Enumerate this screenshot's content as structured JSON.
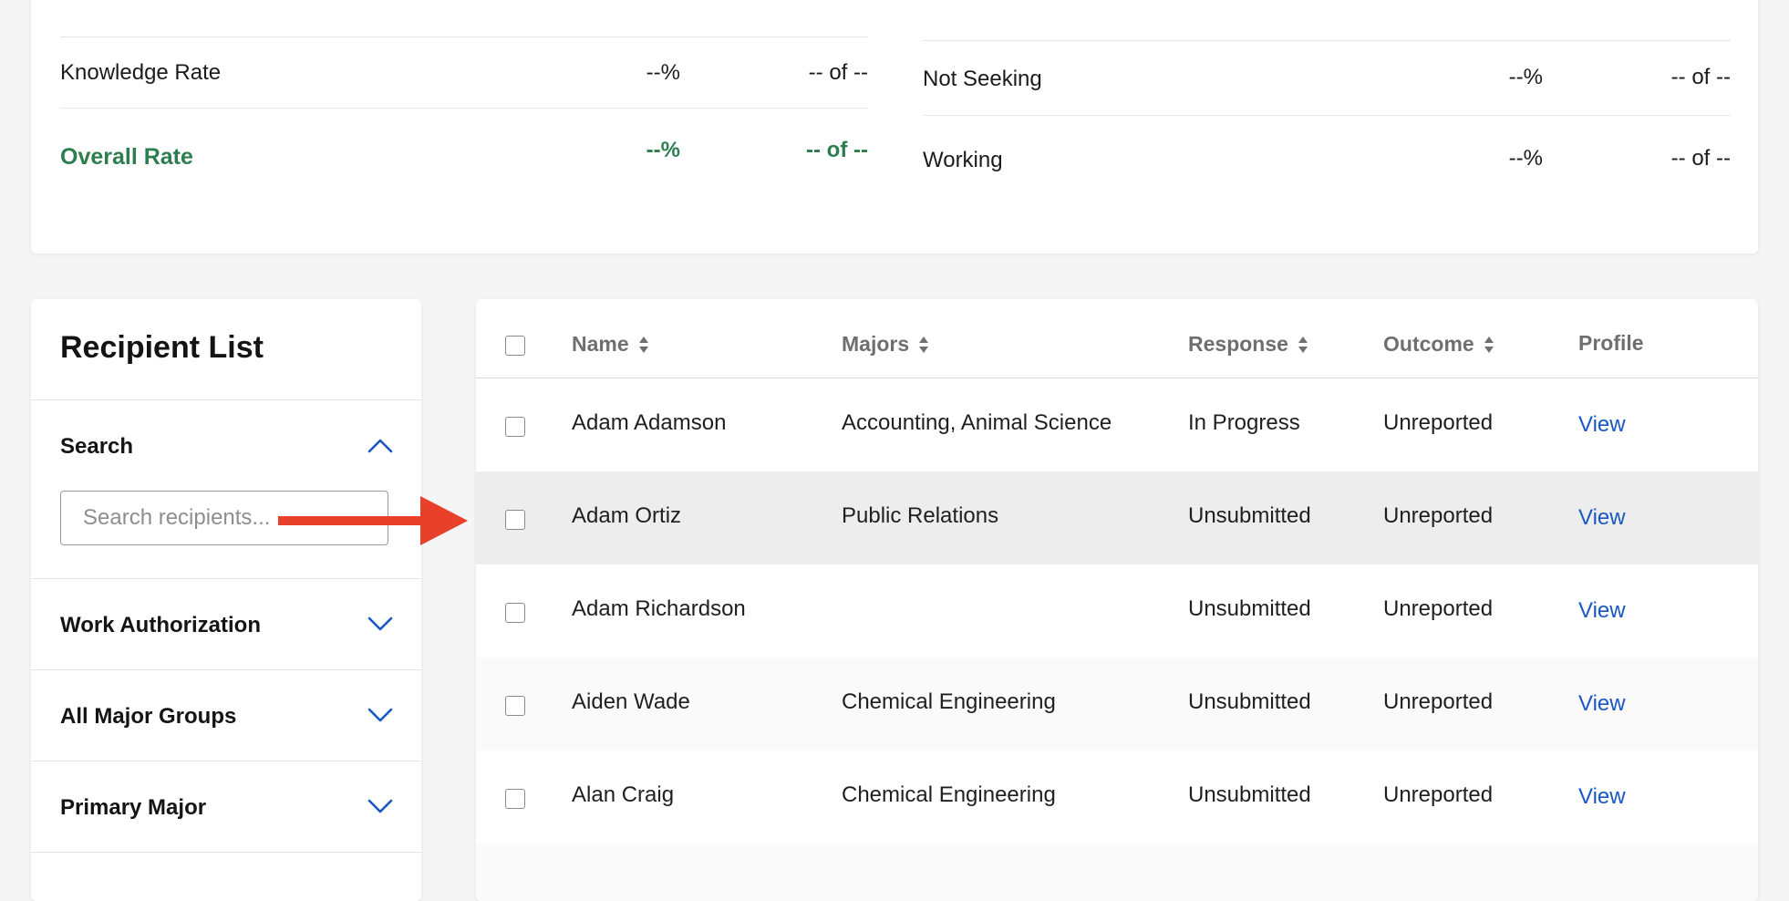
{
  "stats": {
    "left": [
      {
        "label": "Knowledge Rate",
        "pct": "--%",
        "of": "-- of --"
      },
      {
        "label": "Overall Rate",
        "pct": "--%",
        "of": "-- of --"
      }
    ],
    "right": [
      {
        "label": "Not Seeking",
        "pct": "--%",
        "of": "-- of --"
      },
      {
        "label": "Working",
        "pct": "--%",
        "of": "-- of --"
      }
    ]
  },
  "sidebar": {
    "title": "Recipient List",
    "search": {
      "label": "Search",
      "placeholder": "Search recipients..."
    },
    "filters": [
      {
        "label": "Work Authorization"
      },
      {
        "label": "All Major Groups"
      },
      {
        "label": "Primary Major"
      }
    ]
  },
  "table": {
    "headers": {
      "name": "Name",
      "majors": "Majors",
      "response": "Response",
      "outcome": "Outcome",
      "profile": "Profile"
    },
    "rows": [
      {
        "name": "Adam Adamson",
        "majors": "Accounting, Animal Science",
        "response": "In Progress",
        "outcome": "Unreported",
        "profile": "View"
      },
      {
        "name": "Adam Ortiz",
        "majors": "Public Relations",
        "response": "Unsubmitted",
        "outcome": "Unreported",
        "profile": "View"
      },
      {
        "name": "Adam Richardson",
        "majors": "",
        "response": "Unsubmitted",
        "outcome": "Unreported",
        "profile": "View"
      },
      {
        "name": "Aiden Wade",
        "majors": "Chemical Engineering",
        "response": "Unsubmitted",
        "outcome": "Unreported",
        "profile": "View"
      },
      {
        "name": "Alan Craig",
        "majors": "Chemical Engineering",
        "response": "Unsubmitted",
        "outcome": "Unreported",
        "profile": "View"
      }
    ]
  },
  "colors": {
    "accent_green": "#2e7d4f",
    "link_blue": "#1a56c4",
    "arrow_red": "#e8402a",
    "row_hover": "#ededed"
  },
  "icons": {
    "sort": "sort-icon",
    "chevron_up": "chevron-up-icon",
    "chevron_down": "chevron-down-icon",
    "annotation_arrow": "arrow-annotation-icon"
  }
}
